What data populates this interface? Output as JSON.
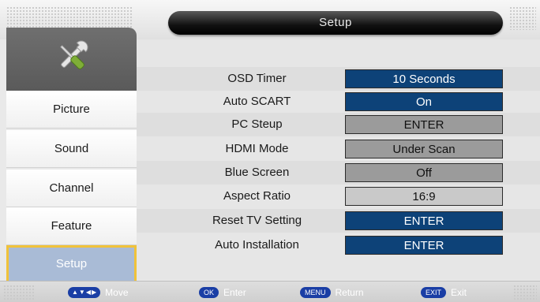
{
  "header": {
    "title": "Setup"
  },
  "sidebar": {
    "items": [
      {
        "label": "Picture"
      },
      {
        "label": "Sound"
      },
      {
        "label": "Channel"
      },
      {
        "label": "Feature"
      },
      {
        "label": "Setup"
      }
    ],
    "active_index": 4
  },
  "settings": {
    "rows": [
      {
        "label": "OSD Timer",
        "value": "10 Seconds"
      },
      {
        "label": "Auto SCART",
        "value": "On"
      },
      {
        "label": "PC Steup",
        "value": "ENTER"
      },
      {
        "label": "HDMI Mode",
        "value": "Under Scan"
      },
      {
        "label": "Blue Screen",
        "value": "Off"
      },
      {
        "label": "Aspect Ratio",
        "value": "16:9"
      },
      {
        "label": "Reset TV Setting",
        "value": "ENTER"
      },
      {
        "label": "Auto Installation",
        "value": "ENTER"
      }
    ]
  },
  "footer": {
    "move_label": "Move",
    "ok_key": "OK",
    "enter_label": "Enter",
    "menu_key": "MENU",
    "return_label": "Return",
    "exit_key": "EXIT",
    "exit_label": "Exit"
  },
  "colors": {
    "selected_blue": "#0d4278",
    "active_tab": "#a9bbd6",
    "active_tab_border": "#f0c23a",
    "key_badge": "#1a3ea5"
  },
  "icons": {
    "category_icon": "tools-icon",
    "navigation": "arrow-keys-icon"
  }
}
